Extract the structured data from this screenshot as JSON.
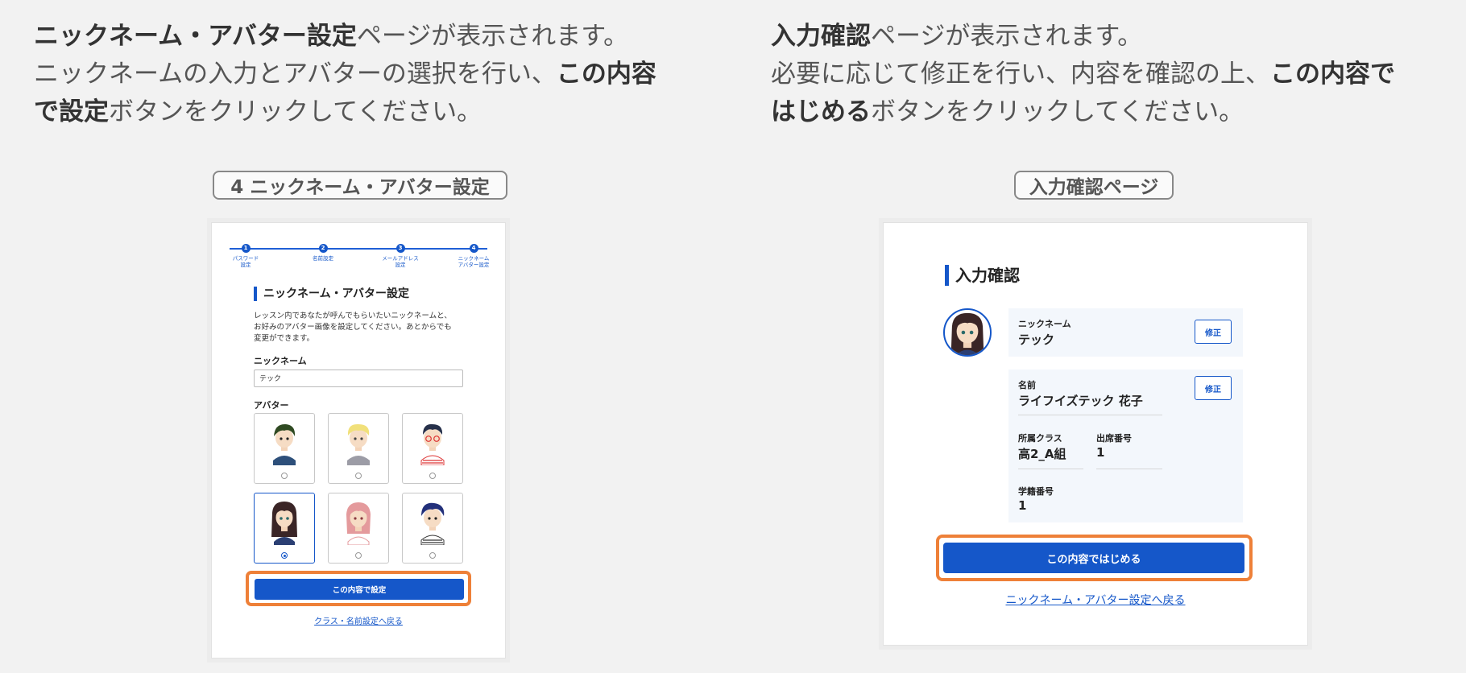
{
  "colors": {
    "primary": "#1557c9",
    "highlight": "#ee8038",
    "background": "#f2f2f2"
  },
  "left_instruction": {
    "line1_bold": "ニックネーム・アバター設定",
    "line1_rest": "ページが表示されます。",
    "line2": "ニックネームの入力とアバターの選択を行い、",
    "line2_bold": "この内容",
    "line3_bold": "で設定",
    "line3_rest": "ボタンをクリックしてください。"
  },
  "right_instruction": {
    "line1_bold": "入力確認",
    "line1_rest": "ページが表示されます。",
    "line2": "必要に応じて修正を行い、内容を確認の上、",
    "line2_bold": "この内容で",
    "line3_bold": "はじめる",
    "line3_rest": "ボタンをクリックしてください。"
  },
  "captions": {
    "left": "4 ニックネーム・アバター設定",
    "right": "入力確認ページ"
  },
  "left_screen": {
    "steps": [
      {
        "num": "1",
        "label": "パスワード\n設定"
      },
      {
        "num": "2",
        "label": "名前設定"
      },
      {
        "num": "3",
        "label": "メールアドレス\n設定"
      },
      {
        "num": "4",
        "label": "ニックネーム\nアバター設定"
      }
    ],
    "title": "ニックネーム・アバター設定",
    "description": "レッスン内であなたが呼んでもらいたいニックネームと、\nお好みのアバター画像を設定してください。あとからでも\n変更ができます。",
    "nickname_label": "ニックネーム",
    "nickname_value": "テック",
    "avatar_label": "アバター",
    "avatars": [
      {
        "icon": "avatar-boy-green-hair-icon",
        "selected": false
      },
      {
        "icon": "avatar-blonde-boy-icon",
        "selected": false
      },
      {
        "icon": "avatar-boy-glasses-icon",
        "selected": false
      },
      {
        "icon": "avatar-girl-dark-hair-icon",
        "selected": true
      },
      {
        "icon": "avatar-girl-pink-hair-icon",
        "selected": false
      },
      {
        "icon": "avatar-boy-navy-hair-icon",
        "selected": false
      }
    ],
    "submit_label": "この内容で設定",
    "back_link": "クラス・名前設定へ戻る"
  },
  "right_screen": {
    "title": "入力確認",
    "nickname_label": "ニックネーム",
    "nickname_value": "テック",
    "edit_label": "修正",
    "name_label": "名前",
    "name_value": "ライフイズテック 花子",
    "class_label": "所属クラス",
    "class_value": "高2_A組",
    "seat_label": "出席番号",
    "seat_value": "1",
    "student_id_label": "学籍番号",
    "student_id_value": "1",
    "submit_label": "この内容ではじめる",
    "back_link": "ニックネーム・アバター設定へ戻る"
  }
}
